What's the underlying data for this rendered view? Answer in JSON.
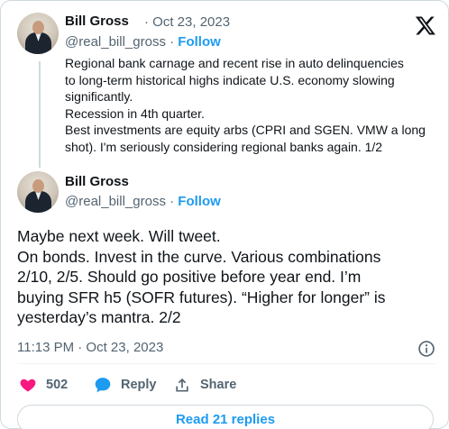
{
  "tweet1": {
    "author_name": "Bill Gross",
    "date": "Oct 23, 2023",
    "handle": "@real_bill_gross",
    "follow_label": "Follow",
    "text_lines": [
      "Regional bank carnage and recent rise in auto delinquencies",
      "to long-term historical highs indicate U.S. economy slowing",
      "significantly.",
      "Recession in 4th quarter.",
      "Best investments are equity arbs (CPRI and SGEN. VMW a long",
      "shot). I'm seriously considering regional banks again. 1/2"
    ]
  },
  "tweet2": {
    "author_name": "Bill Gross",
    "handle": "@real_bill_gross",
    "follow_label": "Follow",
    "text_lines": [
      "Maybe next week. Will tweet.",
      "On bonds. Invest in the curve. Various combinations",
      "2/10, 2/5. Should go positive before year end. I’m",
      "buying SFR h5 (SOFR futures). “Higher for longer” is",
      "yesterday’s mantra. 2/2"
    ],
    "timestamp": "11:13 PM · Oct 23, 2023"
  },
  "actions": {
    "like_count": "502",
    "reply_label": "Reply",
    "share_label": "Share"
  },
  "read_replies_label": "Read 21 replies",
  "separator": "·",
  "colors": {
    "accent": "#1d9bf0",
    "like": "#f91880",
    "secondary_text": "#536471",
    "border": "#cfd9de"
  },
  "icons": [
    "x-logo-icon",
    "info-icon",
    "heart-icon",
    "reply-bubble-icon",
    "share-icon"
  ]
}
